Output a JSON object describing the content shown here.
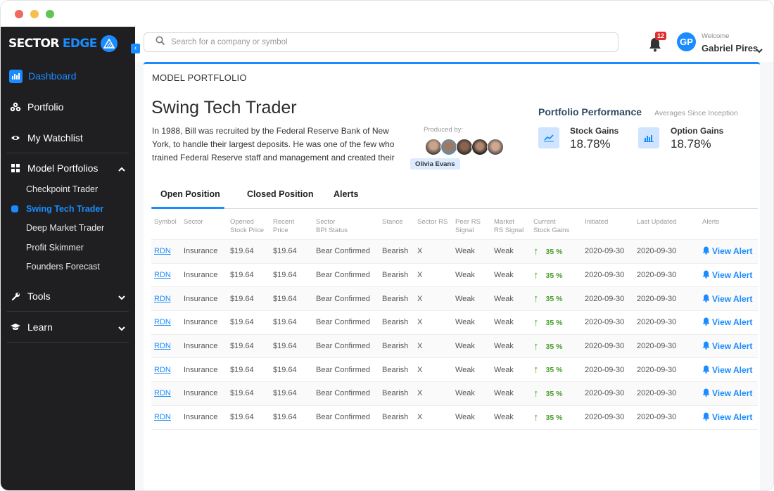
{
  "app": {
    "brand_white": "SECTOR",
    "brand_blue": "EDGE",
    "accent": "#1a8cff"
  },
  "sidebar": {
    "items": [
      {
        "label": "Dashboard",
        "icon": "bar-chart-icon",
        "active": true
      },
      {
        "label": "Portfolio",
        "icon": "coins-icon"
      },
      {
        "label": "My Watchlist",
        "icon": "eye-icon"
      },
      {
        "label": "Model Portfolios",
        "icon": "grid-icon",
        "expanded": true
      },
      {
        "label": "Tools",
        "icon": "wrench-icon"
      },
      {
        "label": "Learn",
        "icon": "graduation-cap-icon"
      }
    ],
    "sub_items": [
      {
        "label": "Checkpoint Trader"
      },
      {
        "label": "Swing Tech Trader",
        "active": true
      },
      {
        "label": "Deep Market Trader"
      },
      {
        "label": "Profit Skimmer"
      },
      {
        "label": "Founders Forecast"
      }
    ]
  },
  "topbar": {
    "search_placeholder": "Search for a company or symbol",
    "notification_count": "12",
    "avatar_initials": "GP",
    "welcome": "Welcome",
    "user_name": "Gabriel Pires"
  },
  "portfolio": {
    "section_label": "MODEL PORTFLOLIO",
    "title": "Swing Tech Trader",
    "description": "In 1988, Bill was recruited by the Federal Reserve Bank of New York, to handle their largest deposits. He was one of the few who trained Federal Reserve staff and management and created their",
    "produced_by_label": "Produced by:",
    "producer_tooltip": "Olivia Evans",
    "performance": {
      "title": "Portfolio Performance",
      "subtitle": "Averages Since Inception",
      "stock_label": "Stock Gains",
      "stock_value": "18.78%",
      "option_label": "Option Gains",
      "option_value": "18.78%"
    }
  },
  "tabs": [
    {
      "label": "Open Position",
      "active": true
    },
    {
      "label": "Closed Position"
    },
    {
      "label": "Alerts"
    }
  ],
  "table": {
    "headers": [
      "Symbol",
      "Sector",
      "Opened\nStock Price",
      "Recent\nPrice",
      "Sector\nBPI Status",
      "Stance",
      "Sector RS",
      "Peer RS\nSignal",
      "Market\nRS Signal",
      "Current\nStock Gains",
      "Initiated",
      "Last Updated",
      "Alerts"
    ],
    "rows": [
      {
        "symbol": "RDN",
        "sector": "Insurance",
        "opened": "$19.64",
        "recent": "$19.64",
        "bpi": "Bear Confirmed",
        "stance": "Bearish",
        "sector_rs": "X",
        "peer_rs": "Weak",
        "market_rs": "Weak",
        "gain": "35 %",
        "initiated": "2020-09-30",
        "updated": "2020-09-30",
        "alert": "View Alert"
      },
      {
        "symbol": "RDN",
        "sector": "Insurance",
        "opened": "$19.64",
        "recent": "$19.64",
        "bpi": "Bear Confirmed",
        "stance": "Bearish",
        "sector_rs": "X",
        "peer_rs": "Weak",
        "market_rs": "Weak",
        "gain": "35 %",
        "initiated": "2020-09-30",
        "updated": "2020-09-30",
        "alert": "View Alert"
      },
      {
        "symbol": "RDN",
        "sector": "Insurance",
        "opened": "$19.64",
        "recent": "$19.64",
        "bpi": "Bear Confirmed",
        "stance": "Bearish",
        "sector_rs": "X",
        "peer_rs": "Weak",
        "market_rs": "Weak",
        "gain": "35 %",
        "initiated": "2020-09-30",
        "updated": "2020-09-30",
        "alert": "View Alert"
      },
      {
        "symbol": "RDN",
        "sector": "Insurance",
        "opened": "$19.64",
        "recent": "$19.64",
        "bpi": "Bear Confirmed",
        "stance": "Bearish",
        "sector_rs": "X",
        "peer_rs": "Weak",
        "market_rs": "Weak",
        "gain": "35 %",
        "initiated": "2020-09-30",
        "updated": "2020-09-30",
        "alert": "View Alert"
      },
      {
        "symbol": "RDN",
        "sector": "Insurance",
        "opened": "$19.64",
        "recent": "$19.64",
        "bpi": "Bear Confirmed",
        "stance": "Bearish",
        "sector_rs": "X",
        "peer_rs": "Weak",
        "market_rs": "Weak",
        "gain": "35 %",
        "initiated": "2020-09-30",
        "updated": "2020-09-30",
        "alert": "View Alert"
      },
      {
        "symbol": "RDN",
        "sector": "Insurance",
        "opened": "$19.64",
        "recent": "$19.64",
        "bpi": "Bear Confirmed",
        "stance": "Bearish",
        "sector_rs": "X",
        "peer_rs": "Weak",
        "market_rs": "Weak",
        "gain": "35 %",
        "initiated": "2020-09-30",
        "updated": "2020-09-30",
        "alert": "View Alert"
      },
      {
        "symbol": "RDN",
        "sector": "Insurance",
        "opened": "$19.64",
        "recent": "$19.64",
        "bpi": "Bear Confirmed",
        "stance": "Bearish",
        "sector_rs": "X",
        "peer_rs": "Weak",
        "market_rs": "Weak",
        "gain": "35 %",
        "initiated": "2020-09-30",
        "updated": "2020-09-30",
        "alert": "View Alert"
      },
      {
        "symbol": "RDN",
        "sector": "Insurance",
        "opened": "$19.64",
        "recent": "$19.64",
        "bpi": "Bear Confirmed",
        "stance": "Bearish",
        "sector_rs": "X",
        "peer_rs": "Weak",
        "market_rs": "Weak",
        "gain": "35 %",
        "initiated": "2020-09-30",
        "updated": "2020-09-30",
        "alert": "View Alert"
      }
    ]
  }
}
